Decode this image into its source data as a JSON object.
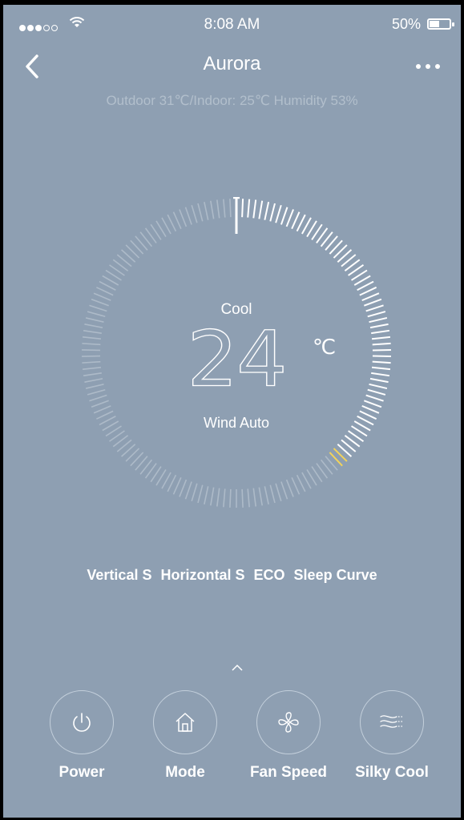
{
  "status_bar": {
    "signal_bars": [
      true,
      true,
      true,
      false,
      false
    ],
    "time": "8:08 AM",
    "battery_text": "50%",
    "battery_level": 0.5
  },
  "header": {
    "title": "Aurora",
    "back_icon": "chevron-left-icon",
    "more_icon": "more-dots-icon"
  },
  "climate_info": "Outdoor 31℃/Indoor: 25℃ Humidity 53%",
  "thermostat": {
    "mode": "Cool",
    "temperature": "24",
    "unit": "℃",
    "wind": "Wind Auto",
    "set_fraction": 0.37
  },
  "functions": [
    "Vertical S",
    "Horizontal S",
    "ECO",
    "Sleep Curve"
  ],
  "controls": [
    {
      "label": "Power",
      "icon": "power-icon"
    },
    {
      "label": "Mode",
      "icon": "home-icon"
    },
    {
      "label": "Fan Speed",
      "icon": "fan-icon"
    },
    {
      "label": "Silky Cool",
      "icon": "airflow-icon"
    }
  ],
  "colors": {
    "background": "#8e9fb2",
    "tick_active": "#ffffff",
    "tick_inactive": "#b8c4d0",
    "tick_marker": "#f3d35a",
    "subtext": "#b2bfcc"
  }
}
